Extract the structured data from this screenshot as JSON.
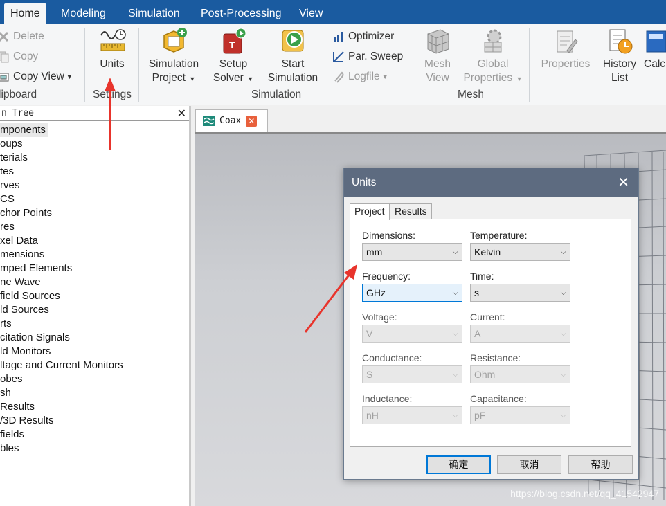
{
  "menu_tabs": [
    "Home",
    "Modeling",
    "Simulation",
    "Post-Processing",
    "View"
  ],
  "ribbon": {
    "clipboard": {
      "delete": "Delete",
      "copy": "Copy",
      "copy_view": "Copy View",
      "group": "lipboard"
    },
    "settings": {
      "units": "Units",
      "group": "Settings"
    },
    "simulation": {
      "sim_project_1": "Simulation",
      "sim_project_2": "Project",
      "setup_solver_1": "Setup",
      "setup_solver_2": "Solver",
      "start_sim_1": "Start",
      "start_sim_2": "Simulation",
      "optimizer": "Optimizer",
      "par_sweep": "Par. Sweep",
      "logfile": "Logfile",
      "group": "Simulation"
    },
    "mesh": {
      "mesh_view_1": "Mesh",
      "mesh_view_2": "View",
      "global_props_1": "Global",
      "global_props_2": "Properties",
      "group": "Mesh"
    },
    "properties": "Properties",
    "history_1": "History",
    "history_2": "List",
    "calc": "Calc"
  },
  "tree": {
    "title": "n Tree",
    "items": [
      "mponents",
      "oups",
      "terials",
      "tes",
      "rves",
      "CS",
      "chor Points",
      "res",
      "xel Data",
      "mensions",
      "mped Elements",
      "ne Wave",
      "field Sources",
      "ld Sources",
      "rts",
      "citation Signals",
      "ld Monitors",
      "ltage and Current Monitors",
      "obes",
      "sh",
      " Results",
      "/3D Results",
      "fields",
      "bles"
    ]
  },
  "doc_tab": {
    "label": "Coax"
  },
  "dialog": {
    "title": "Units",
    "tabs": [
      "Project",
      "Results"
    ],
    "fields": {
      "dimensions": {
        "label": "Dimensions:",
        "value": "mm"
      },
      "temperature": {
        "label": "Temperature:",
        "value": "Kelvin"
      },
      "frequency": {
        "label": "Frequency:",
        "value": "GHz"
      },
      "time": {
        "label": "Time:",
        "value": "s"
      },
      "voltage": {
        "label": "Voltage:",
        "value": "V"
      },
      "current": {
        "label": "Current:",
        "value": "A"
      },
      "conductance": {
        "label": "Conductance:",
        "value": "S"
      },
      "resistance": {
        "label": "Resistance:",
        "value": "Ohm"
      },
      "inductance": {
        "label": "Inductance:",
        "value": "nH"
      },
      "capacitance": {
        "label": "Capacitance:",
        "value": "pF"
      }
    },
    "buttons": {
      "ok": "确定",
      "cancel": "取消",
      "help": "帮助"
    }
  },
  "watermark": "https://blog.csdn.net/qq_41542947",
  "colors": {
    "ribbon_tabbar": "#1a5ba0",
    "dialog_title": "#5d6b80",
    "annotation_arrow": "#e8342c",
    "focus_border": "#0078d7"
  }
}
